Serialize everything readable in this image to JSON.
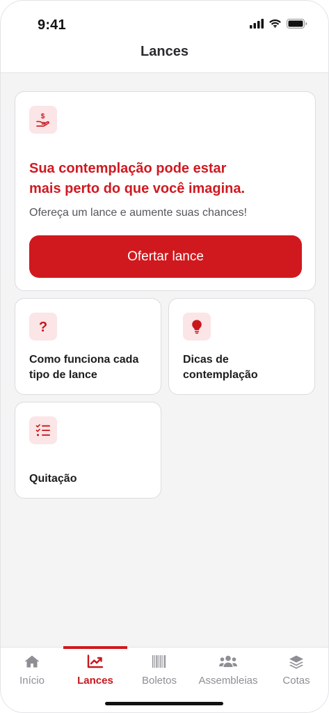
{
  "status_bar": {
    "time": "9:41"
  },
  "header": {
    "title": "Lances"
  },
  "hero": {
    "title_line1": "Sua contemplação pode estar",
    "title_line2": "mais perto do que você imagina.",
    "description": "Ofereça um lance e aumente suas chances!",
    "button_label": "Ofertar lance",
    "icon": "hand-money-icon"
  },
  "tiles": [
    {
      "label_line1": "Como funciona cada",
      "label_line2": "tipo de lance",
      "icon": "question-icon"
    },
    {
      "label_line1": "Dicas de",
      "label_line2": "contemplação",
      "icon": "lightbulb-icon"
    },
    {
      "label_line1": "Quitação",
      "label_line2": "",
      "icon": "checklist-icon"
    }
  ],
  "tabbar": {
    "items": [
      {
        "label": "Início",
        "icon": "home-icon",
        "active": false
      },
      {
        "label": "Lances",
        "icon": "chart-icon",
        "active": true
      },
      {
        "label": "Boletos",
        "icon": "barcode-icon",
        "active": false
      },
      {
        "label": "Assembleias",
        "icon": "people-icon",
        "active": false
      },
      {
        "label": "Cotas",
        "icon": "layers-icon",
        "active": false
      }
    ]
  },
  "colors": {
    "accent": "#d0191e",
    "icon_bg": "#fbe5e6",
    "background": "#f4f4f5"
  }
}
